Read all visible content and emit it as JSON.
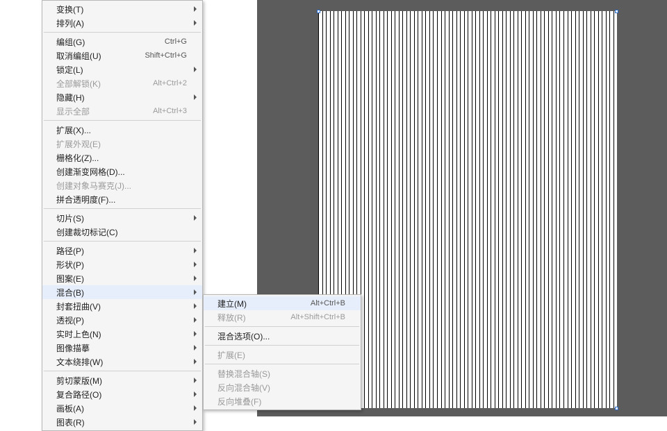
{
  "canvas": {
    "stripe_count": 78
  },
  "menu_main": {
    "groups": [
      [
        {
          "label": "变换(T)",
          "submenu": true
        },
        {
          "label": "排列(A)",
          "submenu": true
        }
      ],
      [
        {
          "label": "编组(G)",
          "shortcut": "Ctrl+G"
        },
        {
          "label": "取消编组(U)",
          "shortcut": "Shift+Ctrl+G"
        },
        {
          "label": "锁定(L)",
          "submenu": true
        },
        {
          "label": "全部解锁(K)",
          "shortcut": "Alt+Ctrl+2",
          "disabled": true
        },
        {
          "label": "隐藏(H)",
          "submenu": true
        },
        {
          "label": "显示全部",
          "shortcut": "Alt+Ctrl+3",
          "disabled": true
        }
      ],
      [
        {
          "label": "扩展(X)..."
        },
        {
          "label": "扩展外观(E)",
          "disabled": true
        },
        {
          "label": "栅格化(Z)..."
        },
        {
          "label": "创建渐变网格(D)..."
        },
        {
          "label": "创建对象马赛克(J)...",
          "disabled": true
        },
        {
          "label": "拼合透明度(F)..."
        }
      ],
      [
        {
          "label": "切片(S)",
          "submenu": true
        },
        {
          "label": "创建裁切标记(C)"
        }
      ],
      [
        {
          "label": "路径(P)",
          "submenu": true
        },
        {
          "label": "形状(P)",
          "submenu": true
        },
        {
          "label": "图案(E)",
          "submenu": true
        },
        {
          "label": "混合(B)",
          "submenu": true,
          "hover": true
        },
        {
          "label": "封套扭曲(V)",
          "submenu": true
        },
        {
          "label": "透视(P)",
          "submenu": true
        },
        {
          "label": "实时上色(N)",
          "submenu": true
        },
        {
          "label": "图像描摹",
          "submenu": true
        },
        {
          "label": "文本绕排(W)",
          "submenu": true
        }
      ],
      [
        {
          "label": "剪切蒙版(M)",
          "submenu": true
        },
        {
          "label": "复合路径(O)",
          "submenu": true
        },
        {
          "label": "画板(A)",
          "submenu": true
        },
        {
          "label": "图表(R)",
          "submenu": true
        }
      ]
    ]
  },
  "menu_sub": {
    "groups": [
      [
        {
          "label": "建立(M)",
          "shortcut": "Alt+Ctrl+B",
          "hover": true
        },
        {
          "label": "释放(R)",
          "shortcut": "Alt+Shift+Ctrl+B",
          "disabled": true
        }
      ],
      [
        {
          "label": "混合选项(O)..."
        }
      ],
      [
        {
          "label": "扩展(E)",
          "disabled": true
        }
      ],
      [
        {
          "label": "替换混合轴(S)",
          "disabled": true
        },
        {
          "label": "反向混合轴(V)",
          "disabled": true
        },
        {
          "label": "反向堆叠(F)",
          "disabled": true
        }
      ]
    ]
  }
}
